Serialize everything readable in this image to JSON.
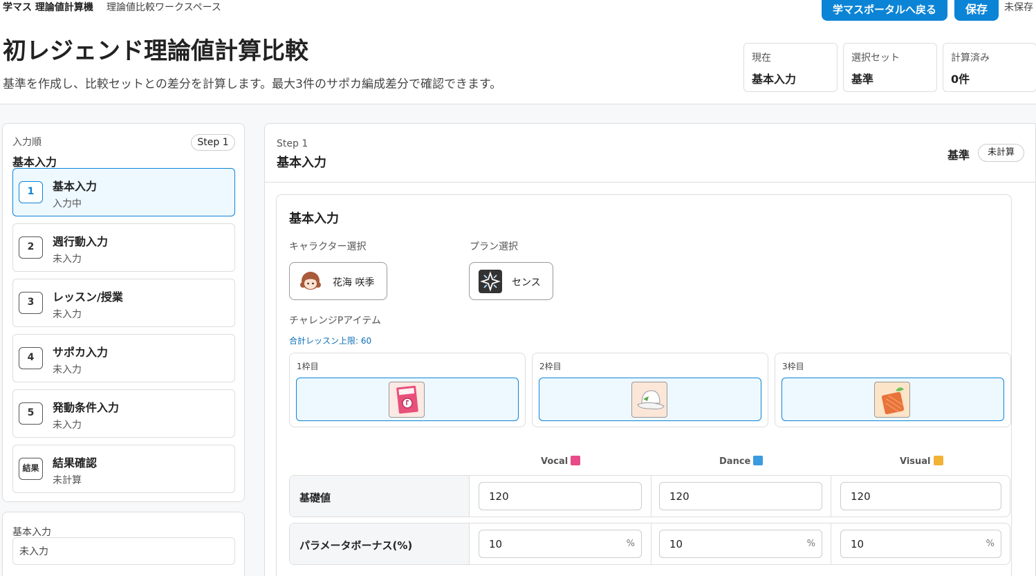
{
  "app": {
    "brand": "学マス 理論値計算機",
    "workspace": "理論値比較ワークスペース",
    "portal_button": "学マスポータルへ戻る",
    "save_button": "保存",
    "save_status": "未保存"
  },
  "page": {
    "title": "初レジェンド理論値計算比較",
    "subtitle": "基準を作成し、比較セットとの差分を計算します。最大3件のサポカ編成差分で確認できます。"
  },
  "status_cards": [
    {
      "label": "現在",
      "value": "基本入力"
    },
    {
      "label": "選択セット",
      "value": "基準"
    },
    {
      "label": "計算済み",
      "value": "0件"
    }
  ],
  "sidebar": {
    "label": "入力順",
    "current": "基本入力",
    "step_badge": "Step 1",
    "steps": [
      {
        "num": "1",
        "title": "基本入力",
        "status": "入力中"
      },
      {
        "num": "2",
        "title": "週行動入力",
        "status": "未入力"
      },
      {
        "num": "3",
        "title": "レッスン/授業",
        "status": "未入力"
      },
      {
        "num": "4",
        "title": "サポカ入力",
        "status": "未入力"
      },
      {
        "num": "5",
        "title": "発動条件入力",
        "status": "未入力"
      },
      {
        "num": "結果",
        "title": "結果確認",
        "status": "未計算"
      }
    ],
    "summary_label": "基本入力",
    "summary_value": "未入力"
  },
  "main": {
    "step_label": "Step 1",
    "title": "基本入力",
    "set_name": "基準",
    "calc_status": "未計算",
    "card_title": "基本入力",
    "character_label": "キャラクター選択",
    "character_name": "花海 咲季",
    "plan_label": "プラン選択",
    "plan_name": "センス",
    "challenge_label": "チャレンジPアイテム",
    "lesson_limit": "合計レッスン上限: 60",
    "slots": [
      {
        "label": "1枠目",
        "icon": "vocal-book-item-icon"
      },
      {
        "label": "2枠目",
        "icon": "bucket-hat-item-icon"
      },
      {
        "label": "3枠目",
        "icon": "orange-charm-item-icon"
      }
    ],
    "columns": [
      {
        "name": "Vocal",
        "color": "#e84a8a"
      },
      {
        "name": "Dance",
        "color": "#3a9be0"
      },
      {
        "name": "Visual",
        "color": "#f2b233"
      }
    ],
    "rows": [
      {
        "label": "基礎値",
        "values": [
          "120",
          "120",
          "120"
        ],
        "unit": ""
      },
      {
        "label": "パラメータボーナス(%)",
        "values": [
          "10",
          "10",
          "10"
        ],
        "unit": "%"
      }
    ]
  }
}
